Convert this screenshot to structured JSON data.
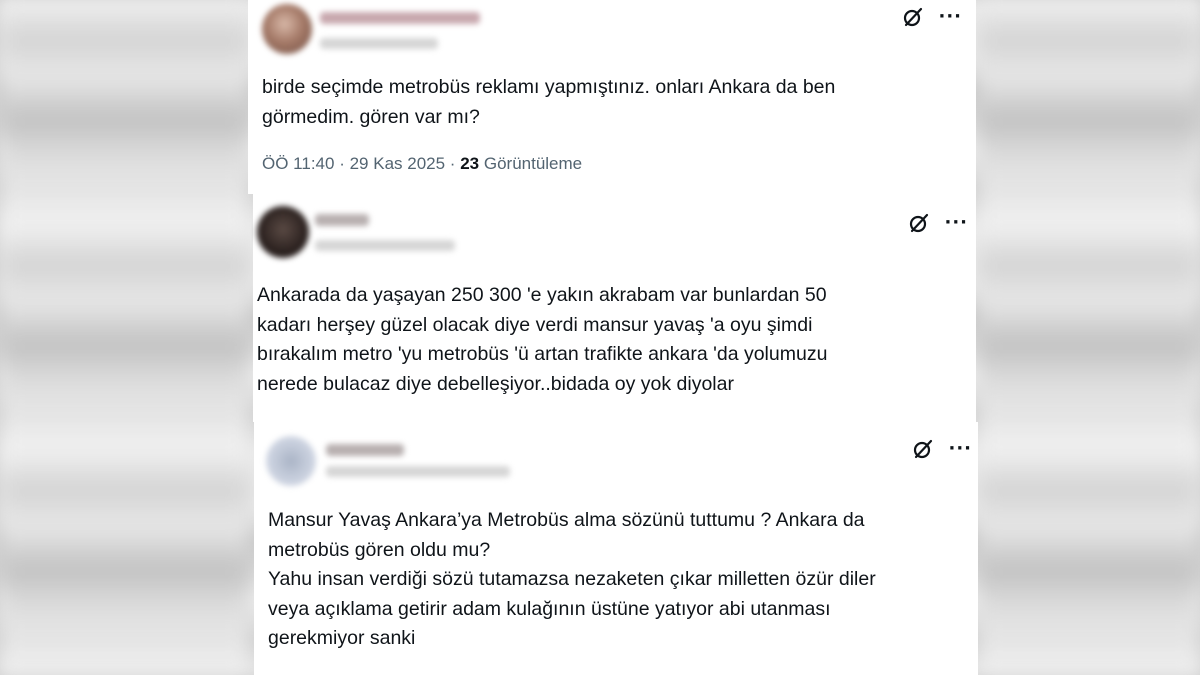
{
  "tweets": [
    {
      "text": "birde seçimde metrobüs reklamı yapmıştınız. onları Ankara  da ben\ngörmedim. gören var mı?",
      "time": "ÖÖ 11:40",
      "date": "29 Kas 2025",
      "views_count": "23",
      "views_label": "Görüntüleme",
      "separator": "·"
    },
    {
      "text": "Ankarada da yaşayan  250 300 'e yakın akrabam  var bunlardan  50\nkadarı  herşey güzel olacak diye  verdi  mansur yavaş 'a  oyu  şimdi\nbırakalım metro 'yu  metrobüs 'ü  artan  trafikte ankara 'da yolumuzu\nnerede bulacaz diye  debelleşiyor..bidada oy  yok diyolar"
    },
    {
      "text": "Mansur Yavaş Ankara’ya Metrobüs alma sözünü tuttumu ? Ankara da\nmetrobüs gören oldu mu?\nYahu insan verdiği sözü tutamazsa nezaketen çıkar milletten özür diler\nveya açıklama getirir adam kulağının üstüne yatıyor abi utanması\ngerekmiyor sanki"
    }
  ],
  "icons": {
    "grok": "grok-icon",
    "more": "more-icon",
    "more_glyph": "···"
  },
  "colors": {
    "text": "#0f1419",
    "meta": "#536471",
    "card_bg": "#ffffff"
  }
}
